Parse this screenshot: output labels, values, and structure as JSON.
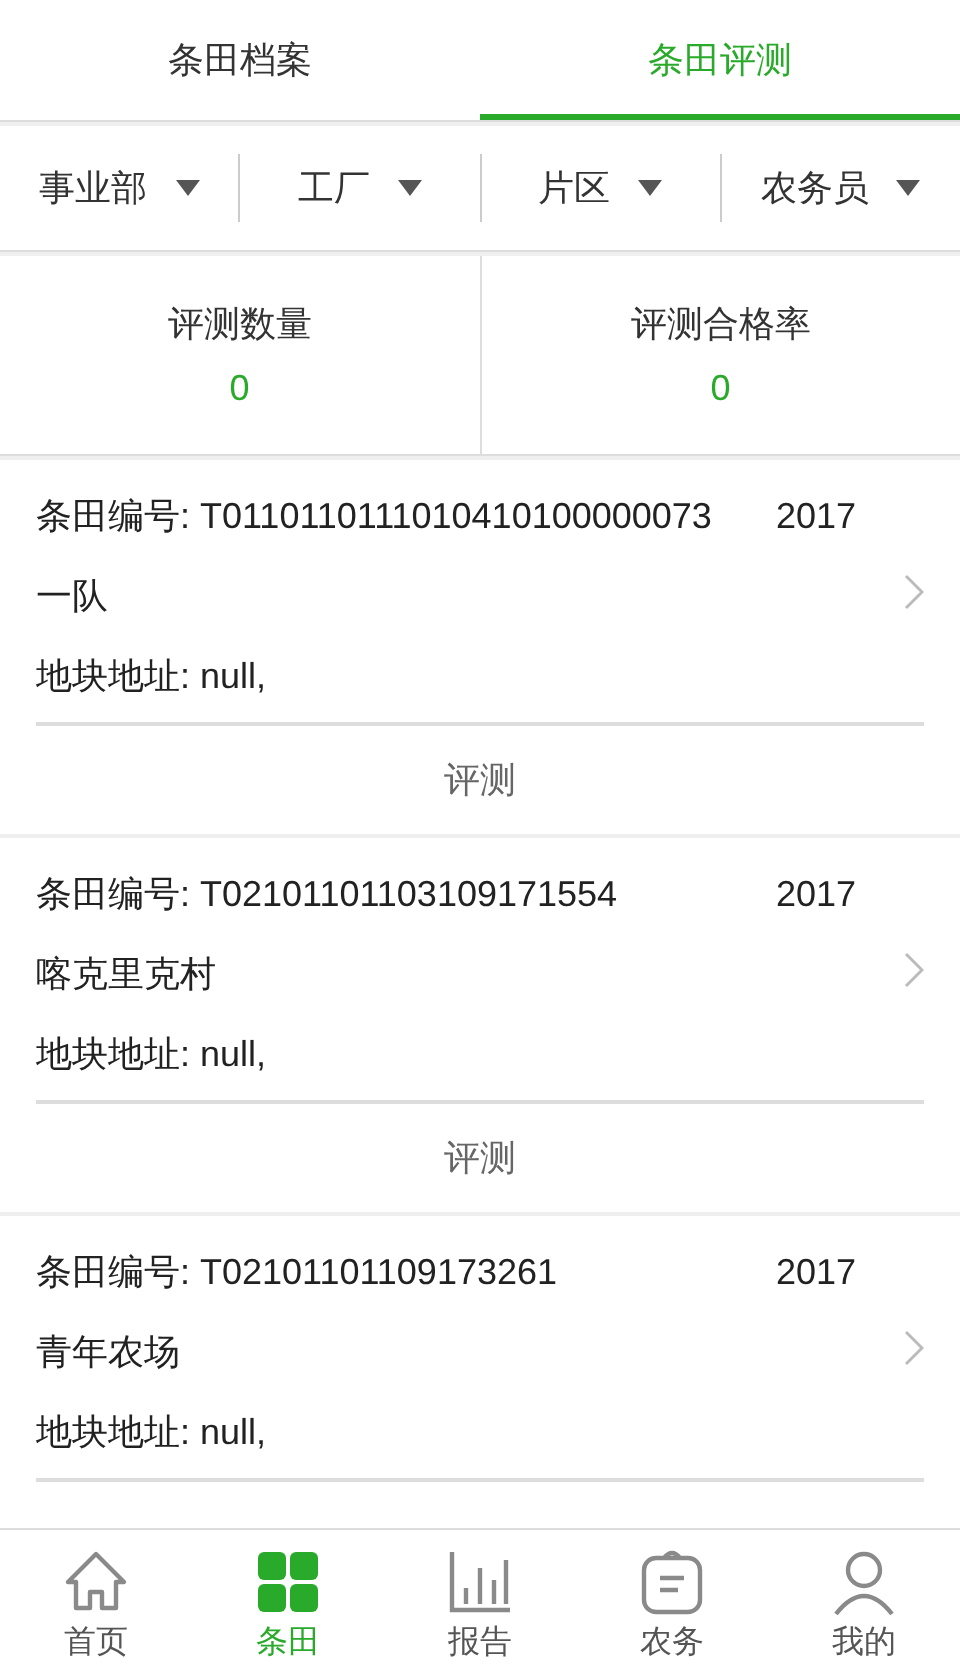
{
  "tabs": [
    {
      "label": "条田档案",
      "selected": false
    },
    {
      "label": "条田评测",
      "selected": true
    }
  ],
  "filters": [
    {
      "label": "事业部"
    },
    {
      "label": "工厂"
    },
    {
      "label": "片区"
    },
    {
      "label": "农务员"
    }
  ],
  "stats": [
    {
      "label": "评测数量",
      "value": "0"
    },
    {
      "label": "评测合格率",
      "value": "0"
    }
  ],
  "fields": [
    {
      "code": "条田编号: T0110110111010410100000073",
      "year": "2017",
      "team": "一队",
      "address": "地块地址: null,",
      "action": "评测"
    },
    {
      "code": "条田编号: T02101101103109171554",
      "year": "2017",
      "team": "喀克里克村",
      "address": "地块地址: null,",
      "action": "评测"
    },
    {
      "code": "条田编号: T02101101109173261",
      "year": "2017",
      "team": "青年农场",
      "address": "地块地址: null,"
    }
  ],
  "nav": [
    {
      "label": "首页",
      "kind": "home",
      "selected": false
    },
    {
      "label": "条田",
      "kind": "grid",
      "selected": true
    },
    {
      "label": "报告",
      "kind": "chart",
      "selected": false
    },
    {
      "label": "农务",
      "kind": "clipboard",
      "selected": false
    },
    {
      "label": "我的",
      "kind": "person",
      "selected": false
    }
  ]
}
